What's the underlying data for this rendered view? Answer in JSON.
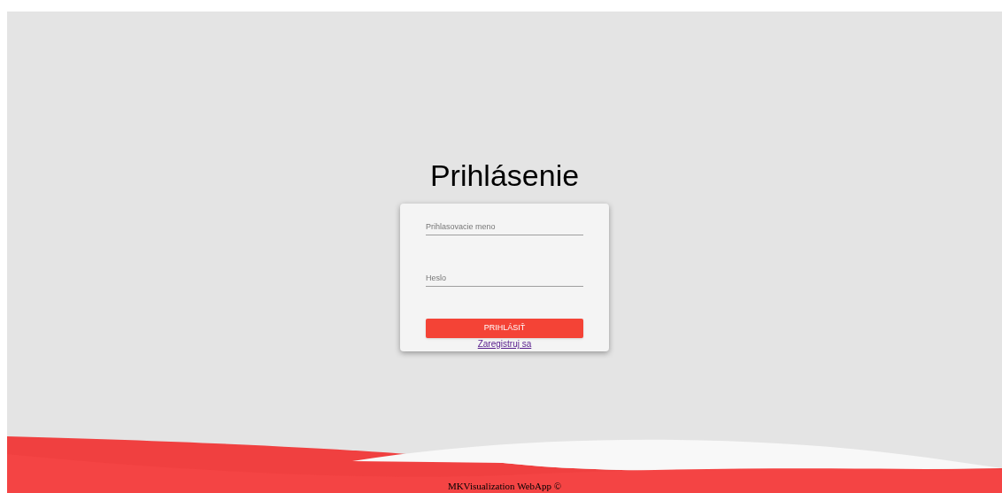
{
  "title": "Prihlásenie",
  "fields": [
    {
      "placeholder": "Prihlasovacie meno"
    },
    {
      "placeholder": "Heslo"
    }
  ],
  "submit_button": "PRIHLÁSIŤ",
  "register_link": "Zaregistruj sa",
  "footer": "MKVisualization WebApp ©"
}
